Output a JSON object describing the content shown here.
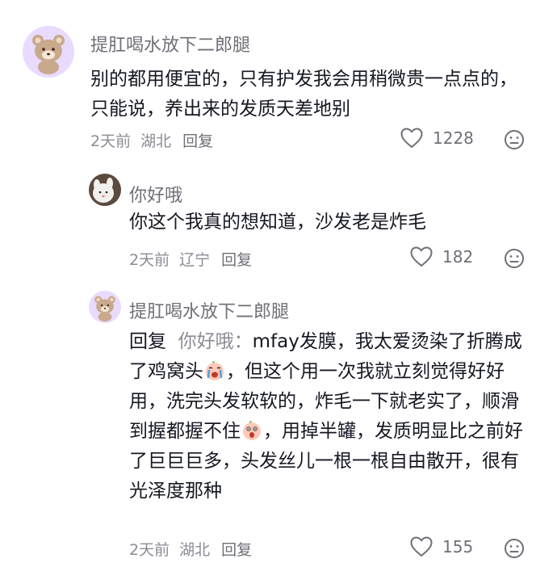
{
  "comments": [
    {
      "username": "提肛喝水放下二郎腿",
      "text": "别的都用便宜的，只有护发我会用稍微贵一点点的，只能说，养出来的发质天差地别",
      "time": "2天前",
      "location": "湖北",
      "reply_label": "回复",
      "likes": "1228",
      "avatar_icon": "bear-avatar-icon"
    },
    {
      "username": "你好哦",
      "text": "你这个我真的想知道，沙发老是炸毛",
      "time": "2天前",
      "location": "辽宁",
      "reply_label": "回复",
      "likes": "182",
      "avatar_icon": "pet-avatar-icon"
    },
    {
      "username": "提肛喝水放下二郎腿",
      "reply_prefix": "回复",
      "reply_target": "你好哦：",
      "text_part1": "mfay发膜，我太爱烫染了折腾成了鸡窝头",
      "text_part2": "，但这个用一次我就立刻觉得好好用，洗完头发软软的，炸毛一下就老实了，顺滑到握都握不住",
      "text_part3": "，用掉半罐，发质明显比之前好了巨巨巨多，头发丝儿一根一根自由散开，很有光泽度那种",
      "emoji1": "crying-face-emoji",
      "emoji2": "shocked-face-emoji",
      "time": "2天前",
      "location": "湖北",
      "reply_label": "回复",
      "likes": "155",
      "avatar_icon": "bear-avatar-icon"
    }
  ]
}
